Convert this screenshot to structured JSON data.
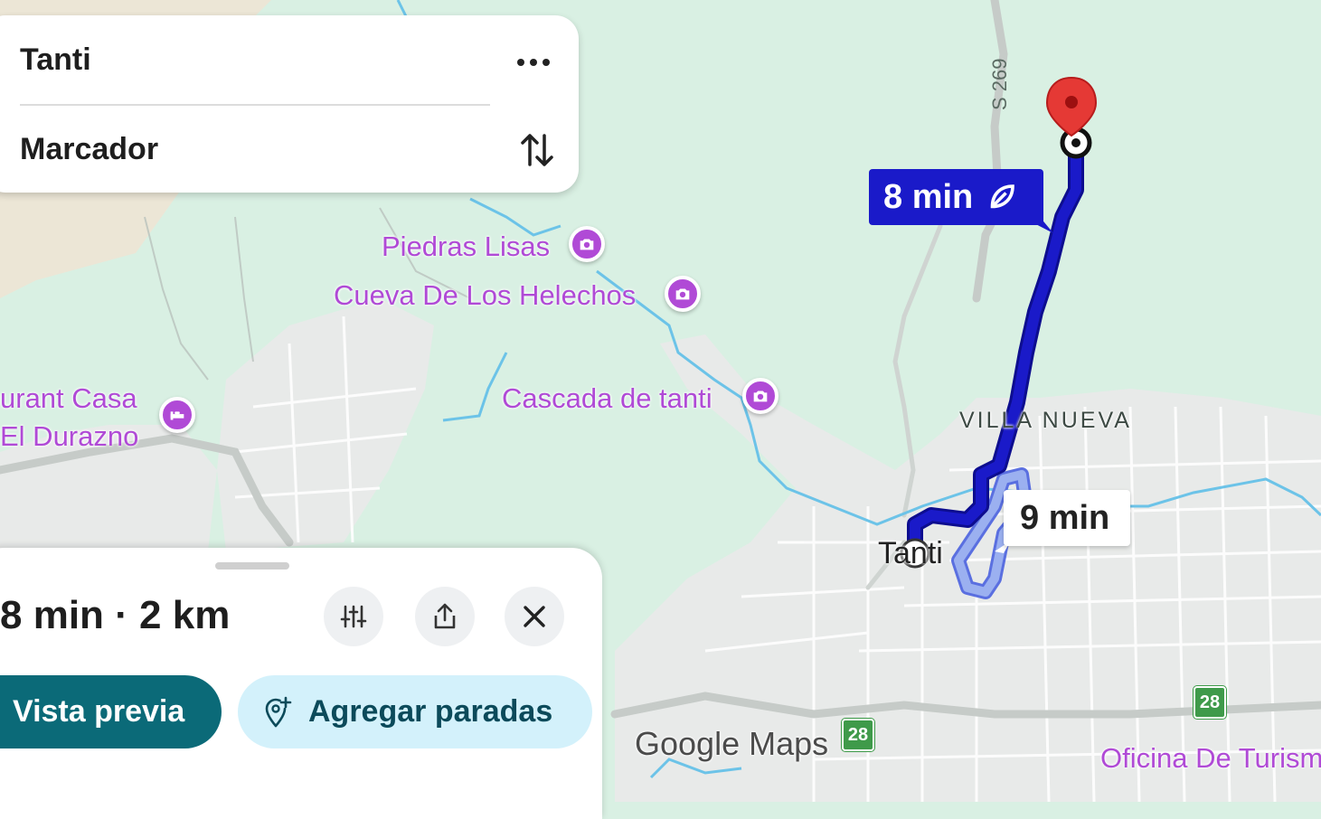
{
  "origin": {
    "label": "Tanti",
    "more_icon": "more-horizontal-icon"
  },
  "destination": {
    "label": "Marcador",
    "swap_icon": "swap-vertical-icon"
  },
  "route": {
    "primary_time": "8 min",
    "primary_icon": "eco-leaf-icon",
    "alt_time": "9 min",
    "color": "#1a1ac9",
    "alt_color": "#9bb0f0"
  },
  "map": {
    "pois": [
      {
        "name": "Piedras Lisas",
        "icon": "camera-icon"
      },
      {
        "name": "Cueva De Los Helechos",
        "icon": "camera-icon"
      },
      {
        "name": "Cascada de tanti",
        "icon": "camera-icon"
      },
      {
        "name": "urant Casa",
        "name2": "El Durazno",
        "icon": "hotel-icon"
      },
      {
        "name": "Oficina De Turism",
        "icon": "poi-icon"
      }
    ],
    "area_label": "VILLA NUEVA",
    "town_label": "Tanti",
    "road_label": "S 269",
    "route_shields": [
      "28",
      "28"
    ],
    "watermark": "Google Maps",
    "colors": {
      "land": "#d9f0e3",
      "urban": "#e8eae9",
      "water": "#6cc3e8",
      "poi": "#b04ad6"
    }
  },
  "sheet": {
    "summary": "8 min · 2 km",
    "options_icon": "tune-icon",
    "share_icon": "share-icon",
    "close_icon": "close-icon",
    "preview_label": "Vista previa",
    "add_stops_label": "Agregar paradas",
    "add_stops_icon": "add-location-icon",
    "primary_color": "#0b6a78",
    "secondary_color": "#d3f1fb"
  }
}
